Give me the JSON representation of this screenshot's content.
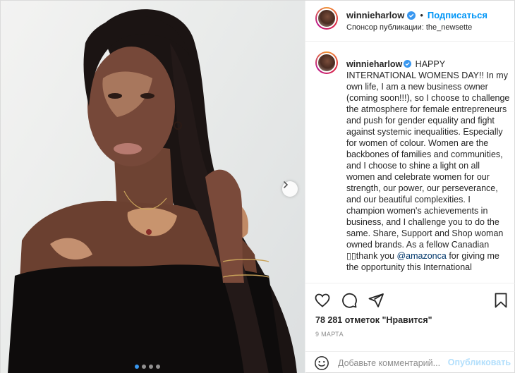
{
  "post": {
    "author": "winnieharlow",
    "follow_label": "Подписаться",
    "separator": "•",
    "sponsor_label": "Спонсор публикации:",
    "sponsor_name": "the_newsette",
    "caption_intro": "HAPPY INTERNATIONAL WOMENS DAY!! In my own life, I am a new business owner (coming soon!!!), so I choose to challenge the atmosphere for female entrepreneurs and push for gender equality and fight against systemic inequalities. Especially for women of colour. Women are the backbones of families and communities, and I choose to shine a light on all women and celebrate women for our strength, our power, our perseverance, and our beautiful complexities. I champion women's achievements in business, and I challenge you to do the same. Share, Support and Shop woman owned brands. As a fellow Canadian",
    "caption_thanks": "thank you",
    "caption_mention": "@amazonca",
    "caption_outro": "for giving me the opportunity this International",
    "likes_text": "78 281 отметок \"Нравится\"",
    "date_text": "9 МАРТА",
    "comment_placeholder": "Добавьте комментарий...",
    "publish_label": "Опубликовать"
  },
  "carousel": {
    "total": 4,
    "active": 0
  },
  "icons": {
    "like": "heart-icon",
    "comment": "comment-icon",
    "share": "share-icon",
    "save": "bookmark-icon",
    "emoji": "smiley-icon",
    "next": "chevron-right-icon",
    "verified": "verified-badge-icon"
  },
  "colors": {
    "accent": "#0095f6",
    "verified": "#3897f0",
    "publish_disabled": "#b2dffc",
    "muted": "#8e8e8e"
  }
}
